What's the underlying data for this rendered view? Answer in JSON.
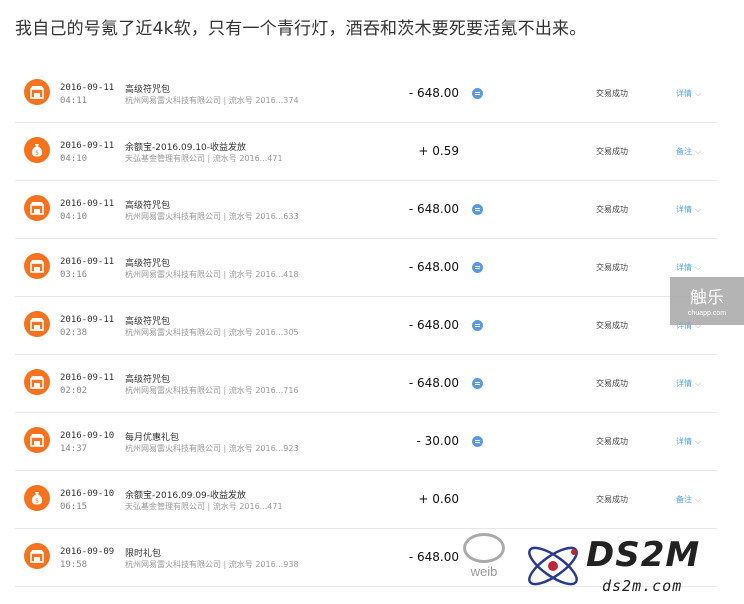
{
  "caption": "我自己的号氪了近4k软，只有一个青行灯，酒吞和茨木要死要活氪不出来。",
  "colors": {
    "icon_bg": "#f5731e",
    "link": "#4aa3df",
    "memo": "#5b9bdb",
    "divider": "#e8e8e8"
  },
  "transactions": [
    {
      "date": "2016-09-11",
      "time": "04:11",
      "icon": "shop-icon",
      "title": "高级符咒包",
      "sub": "杭州网易雷火科技有限公司 | 流水号 2016...374",
      "amount": "- 648.00",
      "memo": true,
      "status": "交易成功",
      "action": "详情"
    },
    {
      "date": "2016-09-11",
      "time": "04:10",
      "icon": "money-bag-icon",
      "title": "余额宝-2016.09.10-收益发放",
      "sub": "天弘基金管理有限公司 | 流水号 2016...471",
      "amount": "+ 0.59",
      "memo": false,
      "status": "交易成功",
      "action": "备注"
    },
    {
      "date": "2016-09-11",
      "time": "04:10",
      "icon": "shop-icon",
      "title": "高级符咒包",
      "sub": "杭州网易雷火科技有限公司 | 流水号 2016...633",
      "amount": "- 648.00",
      "memo": true,
      "status": "交易成功",
      "action": "详情"
    },
    {
      "date": "2016-09-11",
      "time": "03:16",
      "icon": "shop-icon",
      "title": "高级符咒包",
      "sub": "杭州网易雷火科技有限公司 | 流水号 2016...418",
      "amount": "- 648.00",
      "memo": true,
      "status": "交易成功",
      "action": "详情"
    },
    {
      "date": "2016-09-11",
      "time": "02:38",
      "icon": "shop-icon",
      "title": "高级符咒包",
      "sub": "杭州网易雷火科技有限公司 | 流水号 2016...305",
      "amount": "- 648.00",
      "memo": true,
      "status": "交易成功",
      "action": "详情"
    },
    {
      "date": "2016-09-11",
      "time": "02:02",
      "icon": "shop-icon",
      "title": "高级符咒包",
      "sub": "杭州网易雷火科技有限公司 | 流水号 2016...716",
      "amount": "- 648.00",
      "memo": true,
      "status": "交易成功",
      "action": "详情"
    },
    {
      "date": "2016-09-10",
      "time": "14:37",
      "icon": "shop-icon",
      "title": "每月优惠礼包",
      "sub": "杭州网易雷火科技有限公司 | 流水号 2016...923",
      "amount": "- 30.00",
      "memo": true,
      "status": "交易成功",
      "action": "详情"
    },
    {
      "date": "2016-09-10",
      "time": "06:15",
      "icon": "money-bag-icon",
      "title": "余额宝-2016.09.09-收益发放",
      "sub": "天弘基金管理有限公司 | 流水号 2016...471",
      "amount": "+ 0.60",
      "memo": false,
      "status": "交易成功",
      "action": "备注"
    },
    {
      "date": "2016-09-09",
      "time": "19:58",
      "icon": "shop-icon",
      "title": "限时礼包",
      "sub": "杭州网易雷火科技有限公司 | 流水号 2016...938",
      "amount": "- 648.00",
      "memo": false,
      "status": "",
      "action": ""
    }
  ],
  "watermarks": {
    "chuapp_big": "触乐",
    "chuapp_small": "chuapp.com",
    "weibo": "weib",
    "ds2m_name": "DS2M",
    "ds2m_site": "ds2m.com"
  }
}
